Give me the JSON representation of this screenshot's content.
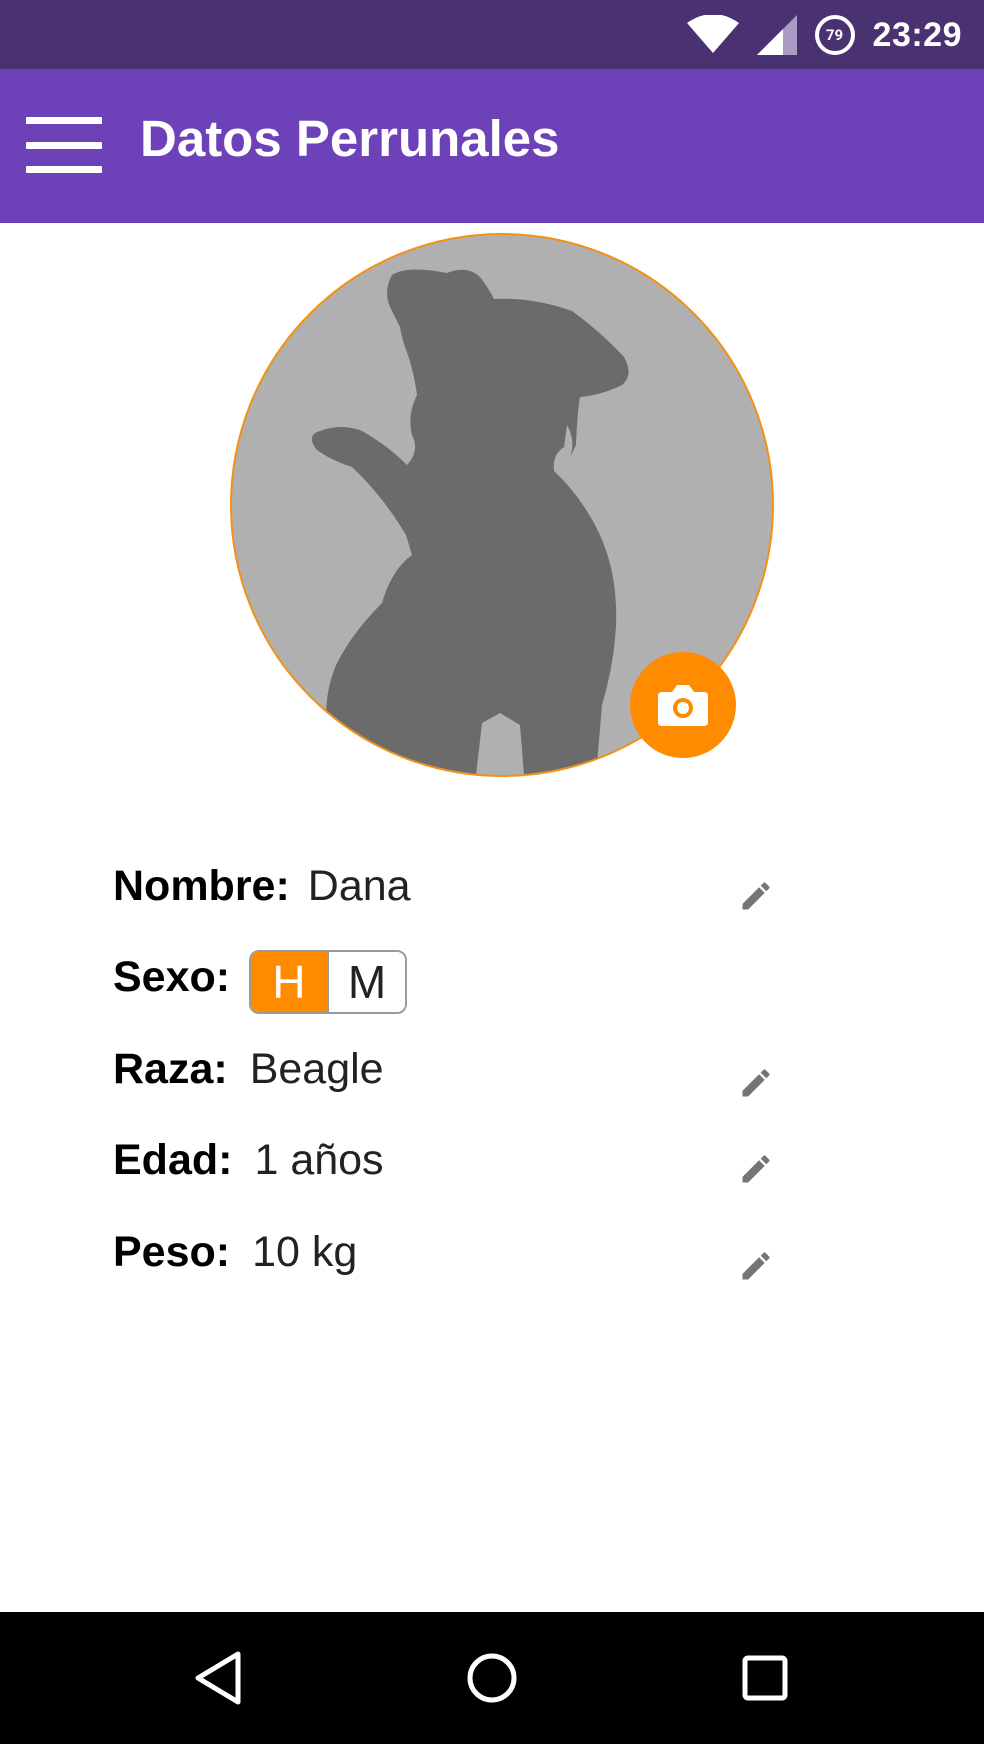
{
  "status": {
    "time": "23:29",
    "battery": "79"
  },
  "appbar": {
    "title": "Datos Perrunales"
  },
  "profile": {
    "nombre": {
      "label": "Nombre:",
      "value": "Dana"
    },
    "sexo": {
      "label": "Sexo:",
      "options": [
        "H",
        "M"
      ],
      "selected": "H"
    },
    "raza": {
      "label": "Raza:",
      "value": "Beagle"
    },
    "edad": {
      "label": "Edad:",
      "value": "1 años"
    },
    "peso": {
      "label": "Peso:",
      "value": "10 kg"
    }
  },
  "colors": {
    "statusbar": "#4a3171",
    "appbar": "#6d42b8",
    "accent": "#ff8c00"
  }
}
